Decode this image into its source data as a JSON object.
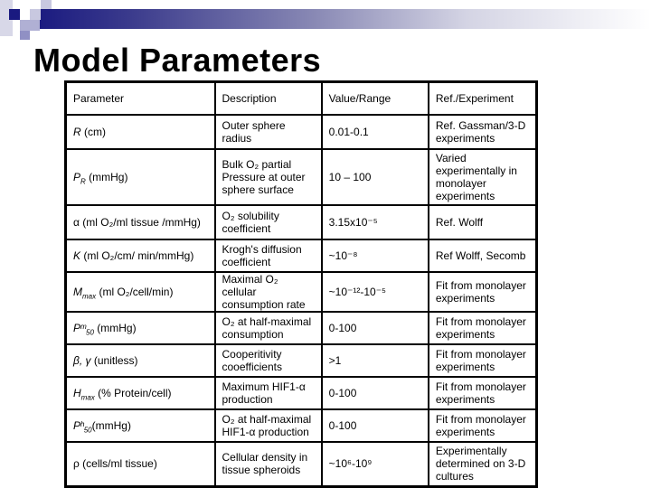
{
  "slide": {
    "title": "Model Parameters",
    "colors": {
      "banner_dark": "#1a1a80",
      "square_dark": "#1a1a80",
      "square_mid": "#9999cc",
      "square_light": "#ccccdd"
    }
  },
  "table": {
    "headers": [
      "Parameter",
      "Description",
      "Value/Range",
      "Ref./Experiment"
    ],
    "rows": [
      {
        "param_symbol": "R",
        "param_sub": "",
        "param_unit": " (cm)",
        "description": "Outer sphere radius",
        "value": "0.01-0.1",
        "ref": "Ref. Gassman/3-D experiments"
      },
      {
        "param_symbol": "P",
        "param_sub": "R",
        "param_unit": " (mmHg)",
        "description": "Bulk O₂ partial Pressure at outer sphere surface",
        "value": "10 – 100",
        "ref": "Varied experimentally in monolayer experiments"
      },
      {
        "param_symbol": "α",
        "param_sub": "",
        "param_unit": " (ml O₂/ml tissue /mmHg)",
        "description": "O₂ solubility coefficient",
        "value": "3.15x10⁻⁵",
        "ref": "Ref. Wolff"
      },
      {
        "param_symbol": "K",
        "param_sub": "",
        "param_unit": " (ml O₂/cm/ min/mmHg)",
        "description": "Krogh's diffusion coefficient",
        "value": "~10⁻⁸",
        "ref": "Ref Wolff, Secomb"
      },
      {
        "param_symbol": "M",
        "param_sub": "max",
        "param_unit": " (ml O₂/cell/min)",
        "description": "Maximal O₂ cellular consumption rate",
        "value": "~10⁻¹²-10⁻⁵",
        "ref": "Fit from monolayer experiments"
      },
      {
        "param_symbol": "Pᵐ",
        "param_sub": "50",
        "param_unit": " (mmHg)",
        "description": "O₂ at half-maximal consumption",
        "value": "0-100",
        "ref": "Fit from monolayer experiments"
      },
      {
        "param_symbol": "β, γ",
        "param_sub": "",
        "param_unit": " (unitless)",
        "description": "Cooperitivity cooefficients",
        "value": ">1",
        "ref": "Fit from monolayer experiments"
      },
      {
        "param_symbol": "H",
        "param_sub": "max",
        "param_unit": " (% Protein/cell)",
        "description": "Maximum HIF1-α production",
        "value": "0-100",
        "ref": "Fit from monolayer experiments"
      },
      {
        "param_symbol": "Pʰ",
        "param_sub": "50",
        "param_unit": "(mmHg)",
        "description": "O₂ at half-maximal HIF1-α production",
        "value": "0-100",
        "ref": "Fit from monolayer experiments"
      },
      {
        "param_symbol": "ρ",
        "param_sub": "",
        "param_unit": " (cells/ml tissue)",
        "description": "Cellular density in tissue spheroids",
        "value": "~10⁶-10⁹",
        "ref": "Experimentally determined on 3-D cultures"
      }
    ]
  }
}
